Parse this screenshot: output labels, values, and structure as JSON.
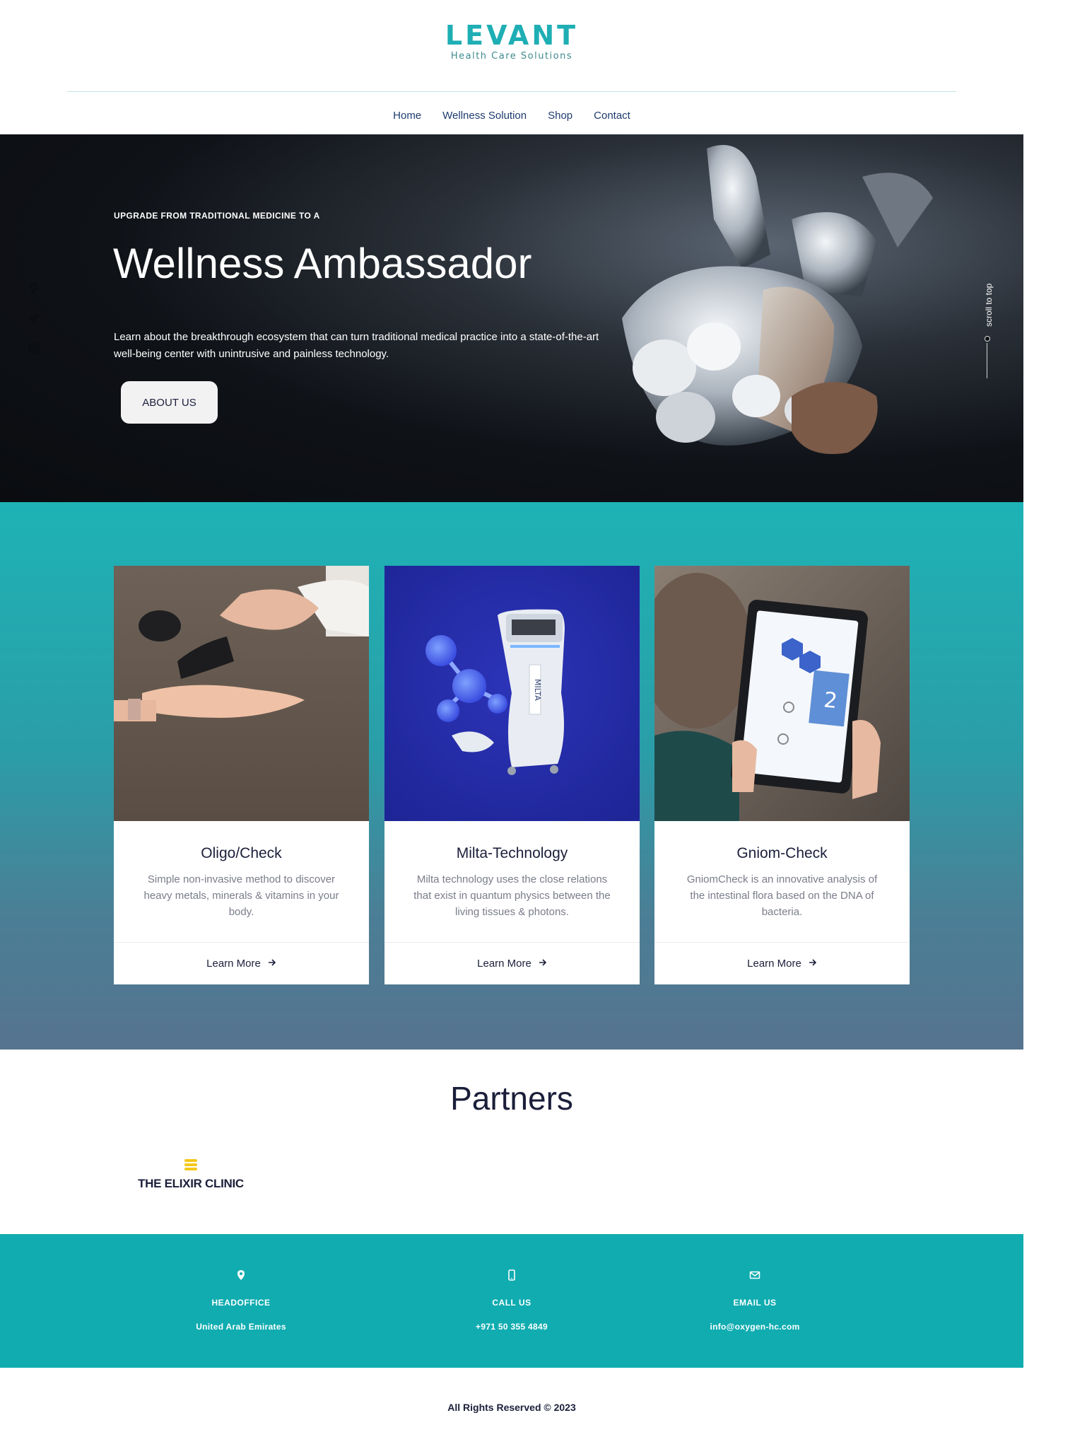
{
  "brand": {
    "name": "LEVANT",
    "tagline": "Health Care Solutions",
    "color": "#1eaeb4"
  },
  "nav": {
    "items": [
      "Home",
      "Wellness Solution",
      "Shop",
      "Contact"
    ]
  },
  "hero": {
    "kicker": "UPGRADE FROM TRADITIONAL MEDICINE TO A",
    "title": "Wellness Ambassador",
    "description": "Learn about the breakthrough ecosystem that can turn traditional medical practice into a state-of-the-art well-being center with unintrusive and painless technology.",
    "button_label": "ABOUT US",
    "scroll_label": "scroll to top",
    "social_icons": [
      "pinterest-icon",
      "twitter-icon",
      "instagram-icon"
    ]
  },
  "services": {
    "cards": [
      {
        "title": "Oligo/Check",
        "description": "Simple non-invasive method to discover heavy metals, minerals & vitamins in your body.",
        "link_label": "Learn More"
      },
      {
        "title": "Milta-Technology",
        "description": "Milta technology uses the close relations that exist in quantum physics between the living tissues & photons.",
        "link_label": "Learn More"
      },
      {
        "title": "Gniom-Check",
        "description": "GniomCheck is an innovative analysis of the intestinal flora based on the DNA of bacteria.",
        "link_label": "Learn More"
      }
    ]
  },
  "partners": {
    "title": "Partners",
    "logos": [
      {
        "name": "THE ELIXIR CLINIC",
        "mark_color": "#f4c81b"
      }
    ]
  },
  "contact": {
    "items": [
      {
        "icon": "map-pin-icon",
        "label": "HEADOFFICE",
        "value": "United Arab Emirates"
      },
      {
        "icon": "phone-icon",
        "label": "CALL US",
        "value": "+971 50 355 4849"
      },
      {
        "icon": "envelope-icon",
        "label": "EMAIL US",
        "value": "info@oxygen-hc.com"
      }
    ]
  },
  "footer": {
    "copyright": "All Rights Reserved © 2023"
  },
  "colors": {
    "teal": "#1eb3b6",
    "navy": "#1b1f3a",
    "contact_band": "#10acb0",
    "milta_blue": "#2a2fa8"
  }
}
